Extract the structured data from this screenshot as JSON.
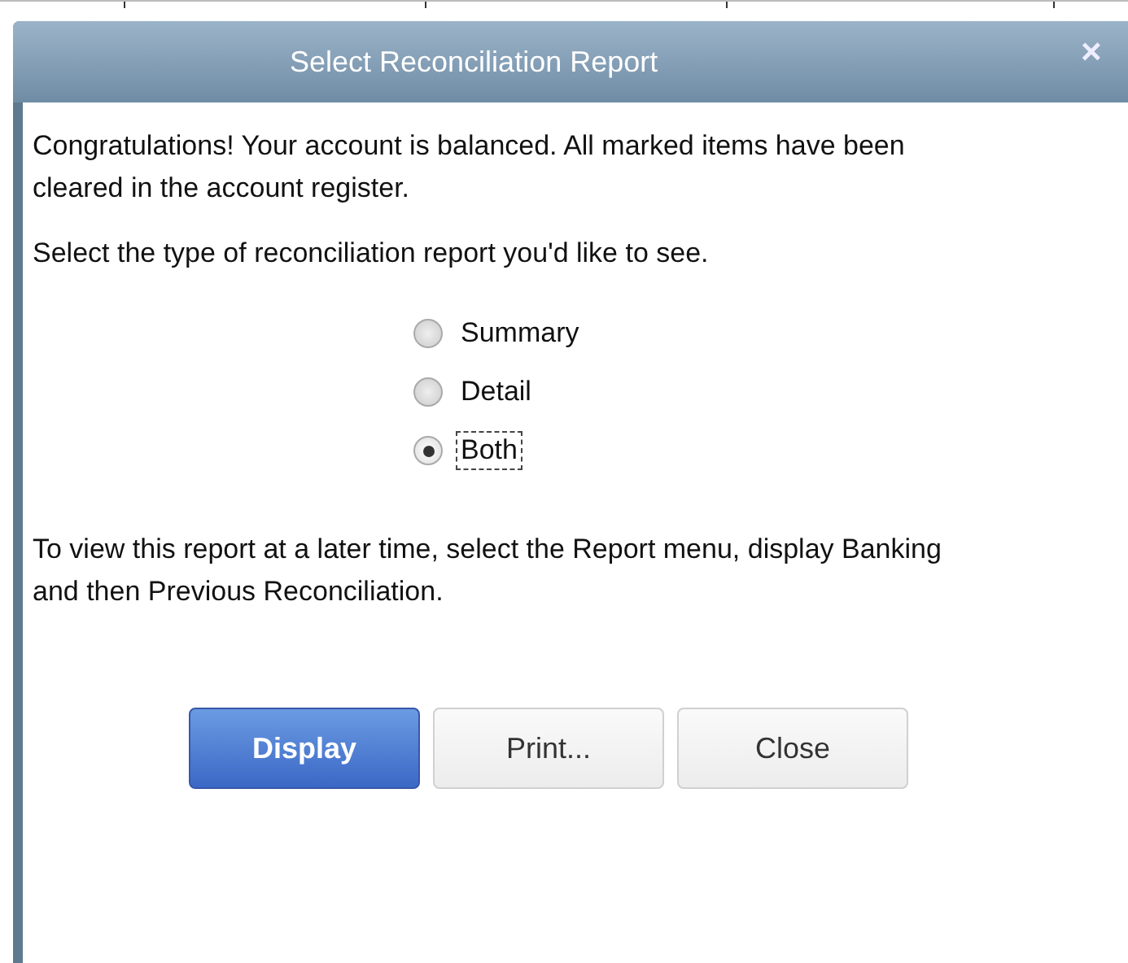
{
  "dialog": {
    "title": "Select Reconciliation Report",
    "close_glyph": "×"
  },
  "message": "Congratulations! Your account is balanced. All marked items have been cleared in the account register.",
  "prompt": "Select the type of reconciliation report you'd like to see.",
  "report_types": [
    {
      "label": "Summary",
      "selected": false
    },
    {
      "label": "Detail",
      "selected": false
    },
    {
      "label": "Both",
      "selected": true
    }
  ],
  "note": "To view this report at a later time, select the Report menu, display Banking and then Previous Reconciliation.",
  "buttons": [
    {
      "label": "Display",
      "kind": "primary"
    },
    {
      "label": "Print...",
      "kind": "normal"
    },
    {
      "label": "Close",
      "kind": "normal"
    }
  ]
}
